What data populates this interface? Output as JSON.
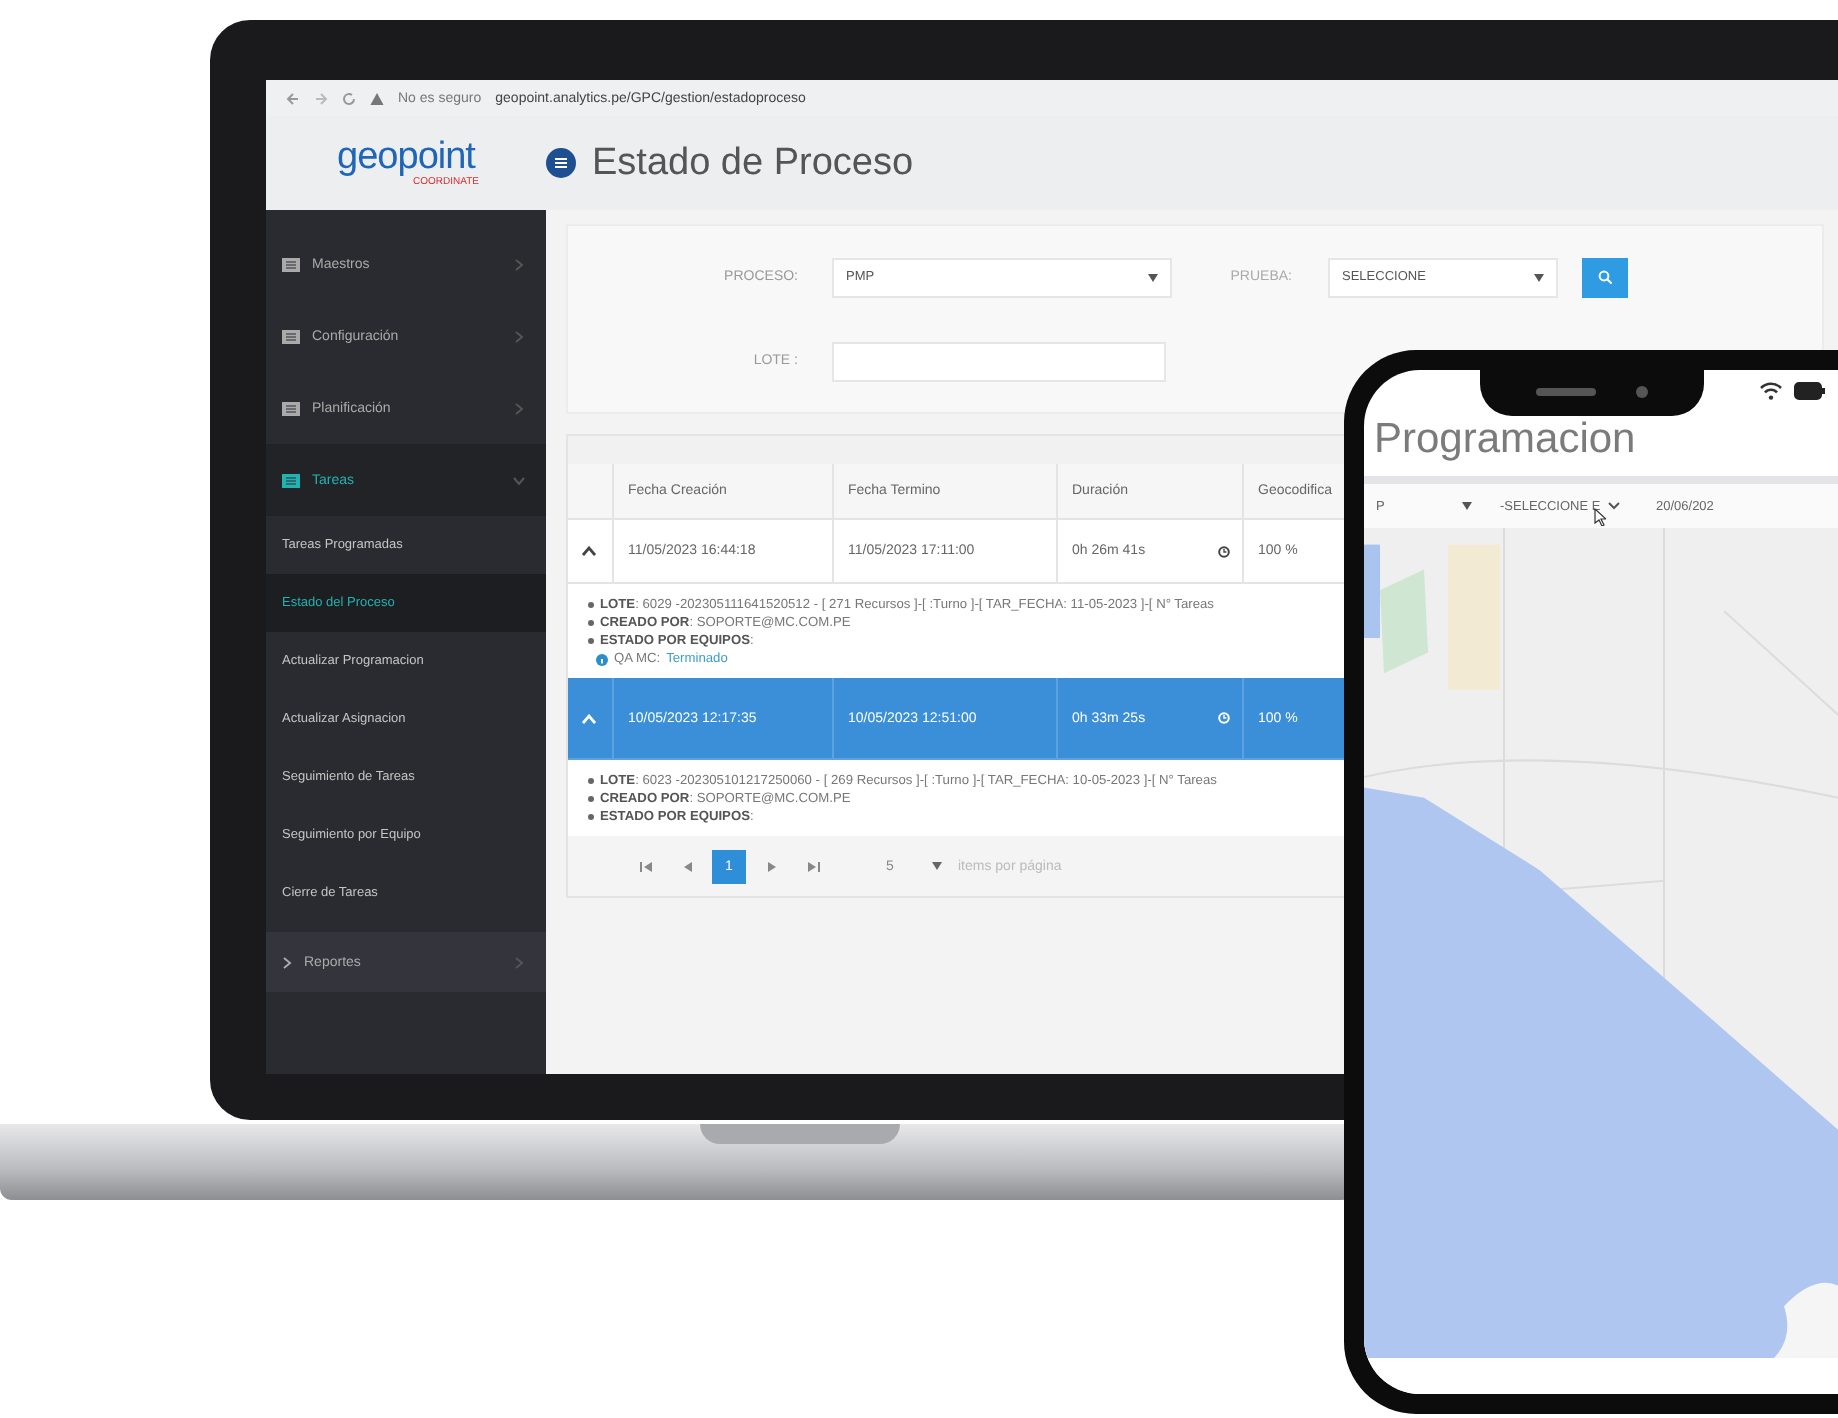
{
  "browser": {
    "security": "No es seguro",
    "url": "geopoint.analytics.pe/GPC/gestion/estadoproceso"
  },
  "header": {
    "logo": "geopoint",
    "logo_subtitle": "COORDINATE",
    "title": "Estado de Proceso"
  },
  "sidebar": {
    "items": [
      {
        "label": "Maestros",
        "kind": "menu",
        "selected": false,
        "expanded": false
      },
      {
        "label": "Configuración",
        "kind": "menu",
        "selected": false,
        "expanded": false
      },
      {
        "label": "Planificación",
        "kind": "menu",
        "selected": false,
        "expanded": false
      },
      {
        "label": "Tareas",
        "kind": "menu",
        "selected": true,
        "expanded": true,
        "children": [
          {
            "label": "Tareas Programadas",
            "selected": false
          },
          {
            "label": "Estado del Proceso",
            "selected": true
          },
          {
            "label": "Actualizar Programacion",
            "selected": false
          },
          {
            "label": "Actualizar Asignacion",
            "selected": false
          },
          {
            "label": "Seguimiento de Tareas",
            "selected": false
          },
          {
            "label": "Seguimiento por Equipo",
            "selected": false
          },
          {
            "label": "Cierre de Tareas",
            "selected": false
          }
        ]
      },
      {
        "label": "Reportes",
        "kind": "group",
        "selected": false,
        "expanded": false
      }
    ]
  },
  "filters": {
    "proceso": {
      "label": "PROCESO:",
      "value": "PMP"
    },
    "prueba": {
      "label": "PRUEBA:",
      "value": "SELECCIONE"
    },
    "lote": {
      "label": "LOTE :"
    }
  },
  "table": {
    "columns": [
      "Fecha Creación",
      "Fecha Termino",
      "Duración",
      "Geocodifica"
    ],
    "rows": [
      {
        "selected": false,
        "expanded": true,
        "created": "11/05/2023 16:44:18",
        "finished": "11/05/2023 17:11:00",
        "duration": "0h 26m 41s",
        "geocoded": "100 %",
        "details": [
          "**LOTE**: 6029 -202305111641520512 - [ 271 Recursos ]-[ :Turno ]-[ TAR_FECHA: 11-05-2023 ]-[ N° Tareas",
          "**CREADO POR**: SOPORTE@MC.COM.PE",
          "**ESTADO POR EQUIPOS**:"
        ],
        "team_status": {
          "team": "QA MC:",
          "state": "Terminado"
        }
      },
      {
        "selected": true,
        "expanded": true,
        "created": "10/05/2023 12:17:35",
        "finished": "10/05/2023 12:51:00",
        "duration": "0h 33m 25s",
        "geocoded": "100 %",
        "details": [
          "**LOTE**: 6023 -202305101217250060 - [ 269 Recursos ]-[ :Turno ]-[ TAR_FECHA: 10-05-2023 ]-[ N° Tareas",
          "**CREADO POR**: SOPORTE@MC.COM.PE",
          "**ESTADO POR EQUIPOS**:"
        ]
      }
    ]
  },
  "pager": {
    "pages": [
      {
        "label": "1",
        "selected": true
      }
    ],
    "page_size": "5",
    "page_size_label": "items por página"
  },
  "phone": {
    "title": "Programacion",
    "filter_1": "P",
    "filter_2": "-SELECCIONE E",
    "date": "20/06/202"
  }
}
